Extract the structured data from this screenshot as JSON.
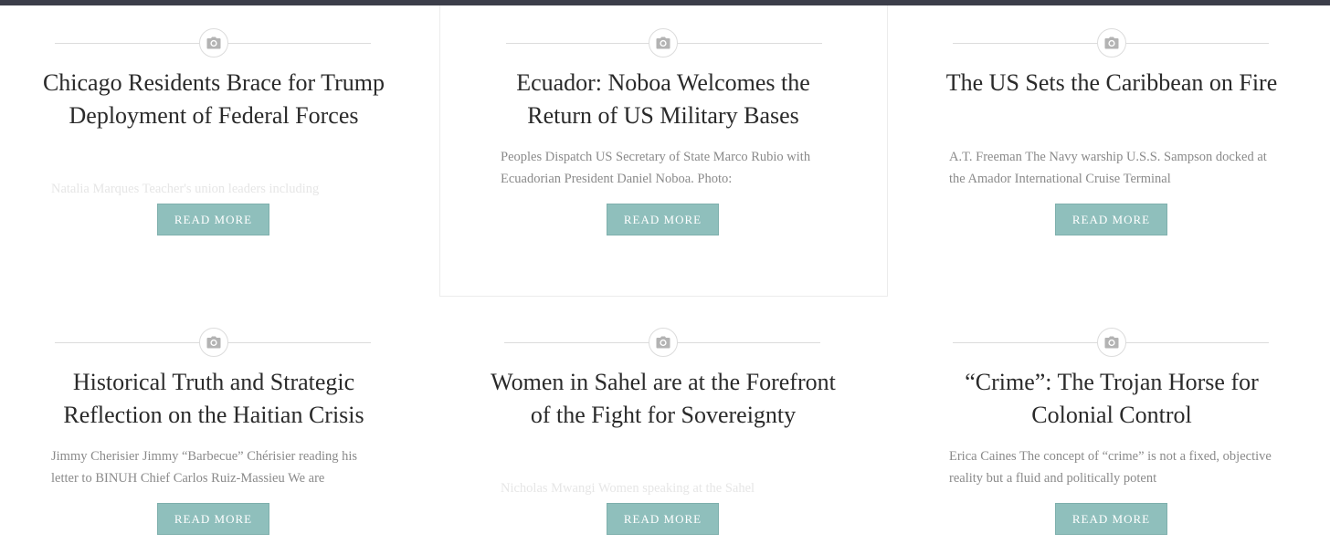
{
  "posts": [
    {
      "title": "Chicago Residents Brace for Trump Deployment of Federal Forces",
      "excerpt": "Natalia Marques Teacher's union leaders including",
      "read_more": "READ MORE",
      "icon": "camera-icon"
    },
    {
      "title": "Ecuador: Noboa Welcomes the Return of US Military Bases",
      "excerpt": "Peoples Dispatch US Secretary of State Marco Rubio with Ecuadorian President Daniel Noboa. Photo:",
      "read_more": "READ MORE",
      "icon": "camera-icon"
    },
    {
      "title": "The US Sets the Caribbean on Fire",
      "excerpt": "A.T. Freeman The Navy warship U.S.S. Sampson docked at the Amador International Cruise Terminal",
      "read_more": "READ MORE",
      "icon": "camera-icon"
    },
    {
      "title": "Historical Truth and Strategic Reflection on the Haitian Crisis",
      "excerpt": "Jimmy Cherisier Jimmy “Barbecue” Chérisier reading his letter to BINUH Chief Carlos Ruiz-Massieu We are",
      "read_more": "READ MORE",
      "icon": "camera-icon"
    },
    {
      "title": "Women in Sahel are at the Forefront of the Fight for Sovereignty",
      "excerpt": "Nicholas Mwangi Women speaking at the Sahel",
      "read_more": "READ MORE",
      "icon": "camera-icon"
    },
    {
      "title": "“Crime”: The Trojan Horse for Colonial Control",
      "excerpt": "Erica Caines The concept of “crime” is not a fixed, objective reality but a fluid and politically potent",
      "read_more": "READ MORE",
      "icon": "camera-icon"
    }
  ],
  "colors": {
    "topbar": "#3c3e4a",
    "button": "#8fbfbc",
    "title": "#2a2a2a",
    "excerpt": "#8a8a8a"
  }
}
